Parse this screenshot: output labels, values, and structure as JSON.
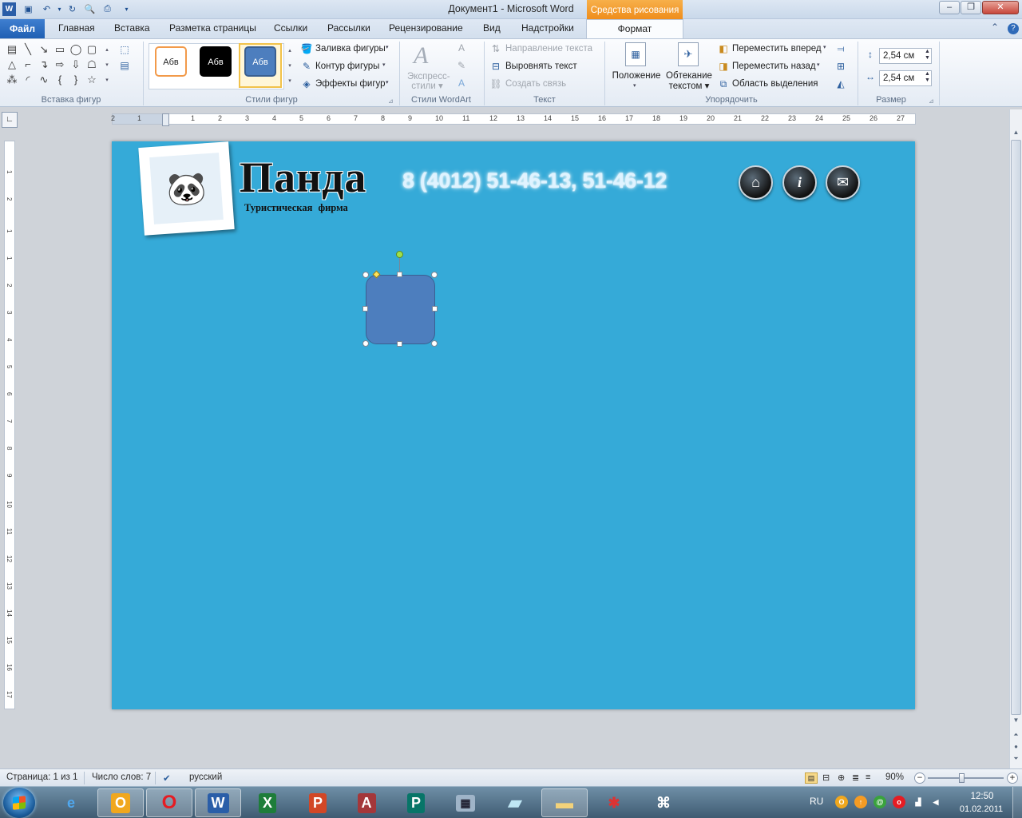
{
  "window": {
    "title": "Документ1  -  Microsoft Word",
    "context_tab": "Средства рисования",
    "buttons": {
      "minimize": "–",
      "maximize": "❐",
      "close": "✕"
    }
  },
  "tabs": {
    "file": "Файл",
    "items": [
      "Главная",
      "Вставка",
      "Разметка страницы",
      "Ссылки",
      "Рассылки",
      "Рецензирование",
      "Вид",
      "Надстройки"
    ],
    "active": "Формат"
  },
  "ribbon": {
    "groups": {
      "insert_shapes": "Вставка фигур",
      "shape_styles": "Стили фигур",
      "wordart_styles": "Стили WordArt",
      "text": "Текст",
      "arrange": "Упорядочить",
      "size": "Размер"
    },
    "style_swatches": [
      "Абв",
      "Абв",
      "Абв"
    ],
    "shape_commands": [
      "Заливка фигуры",
      "Контур фигуры",
      "Эффекты фигур"
    ],
    "express_styles": [
      "Экспресс-",
      "стили"
    ],
    "text_commands": {
      "direction": "Направление текста",
      "align": "Выровнять текст",
      "link": "Создать связь"
    },
    "position": "Положение",
    "wrap": [
      "Обтекание",
      "текстом"
    ],
    "arrange_commands": [
      "Переместить вперед",
      "Переместить назад",
      "Область выделения"
    ],
    "size": {
      "height": "2,54 см",
      "width": "2,54 см"
    }
  },
  "ruler": {
    "h_ticks": [
      "2",
      "1",
      "1",
      "2",
      "3",
      "4",
      "5",
      "6",
      "7",
      "8",
      "9",
      "10",
      "11",
      "12",
      "13",
      "14",
      "15",
      "16",
      "17",
      "18",
      "19",
      "20",
      "21",
      "22",
      "23",
      "24",
      "25",
      "26",
      "27"
    ],
    "v_ticks": [
      "1",
      "2",
      "1",
      "1",
      "2",
      "3",
      "4",
      "5",
      "6",
      "7",
      "8",
      "9",
      "10",
      "11",
      "12",
      "13",
      "14",
      "15",
      "16",
      "17"
    ]
  },
  "document": {
    "brand": "Панда",
    "tagline": "Туристическая  фирма",
    "phones": "8 (4012) 51-46-13, 51-46-12",
    "nav_icons": [
      "home-icon",
      "info-icon",
      "mail-icon"
    ],
    "accent_color": "#35aad8",
    "shape_color": "#4d7ebe"
  },
  "status": {
    "page": "Страница: 1 из 1",
    "words": "Число слов: 7",
    "language": "русский",
    "zoom": "90%"
  },
  "taskbar": {
    "apps": [
      "ie-icon",
      "outlook-icon",
      "opera-icon",
      "word-icon",
      "excel-icon",
      "powerpoint-icon",
      "access-icon",
      "publisher-icon",
      "calculator-icon",
      "notes-icon",
      "explorer-icon",
      "spiderman-icon",
      "script-icon"
    ],
    "lang": "RU",
    "time": "12:50",
    "date": "01.02.2011"
  }
}
